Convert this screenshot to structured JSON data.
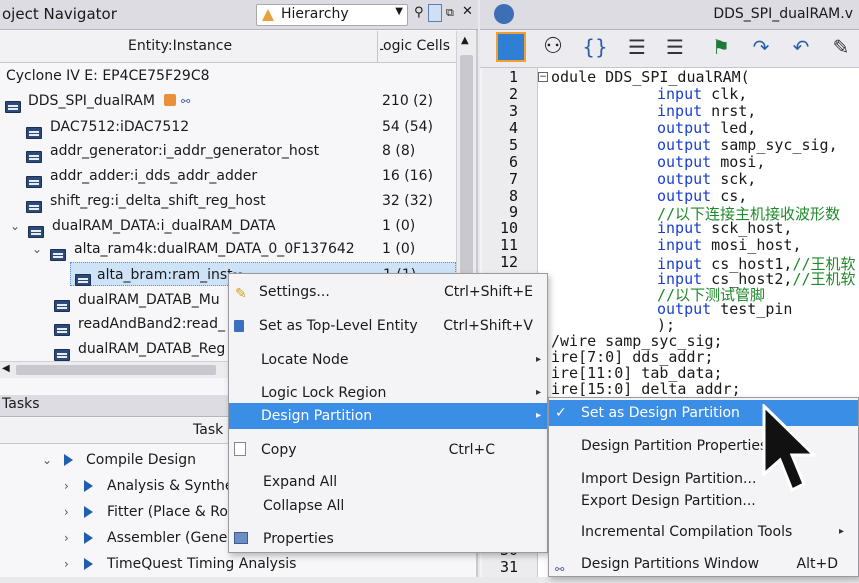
{
  "navigator": {
    "title": "oject Navigator",
    "view_select": "Hierarchy",
    "col_entity": "Entity:Instance",
    "col_cells": "Logic Cells",
    "device": "Cyclone IV E: EP4CE75F29C8",
    "rows": [
      {
        "label": "DDS_SPI_dualRAM",
        "cells": "210 (2)"
      },
      {
        "label": "DAC7512:iDAC7512",
        "cells": "54 (54)"
      },
      {
        "label": "addr_generator:i_addr_generator_host",
        "cells": "8 (8)"
      },
      {
        "label": "addr_adder:i_dds_addr_adder",
        "cells": "16 (16)"
      },
      {
        "label": "shift_reg:i_delta_shift_reg_host",
        "cells": "32 (32)"
      },
      {
        "label": "dualRAM_DATA:i_dualRAM_DATA",
        "cells": "1 (0)"
      },
      {
        "label": "alta_ram4k:dualRAM_DATA_0_0F137642",
        "cells": "1 (0)"
      },
      {
        "label": "alta_bram:ram_inst",
        "cells": "1 (1)"
      },
      {
        "label": "dualRAM_DATAB_Mu",
        "cells": ""
      },
      {
        "label": "readAndBand2:read_",
        "cells": ""
      },
      {
        "label": "dualRAM_DATAB_Reg",
        "cells": ""
      }
    ]
  },
  "tasks": {
    "title": "Tasks",
    "col_task": "Task",
    "items": [
      "Compile Design",
      "Analysis & Synthe",
      "Fitter (Place & Rou",
      "Assembler (Genera",
      "TimeQuest Timing Analysis"
    ]
  },
  "editor": {
    "tab_title": "DDS_SPI_dualRAM.v",
    "line_numbers": [
      "1",
      "2",
      "3",
      "4",
      "5",
      "6",
      "7",
      "8",
      "9",
      "10",
      "11",
      "12",
      "",
      "",
      "",
      "",
      "",
      "",
      "",
      "",
      "",
      "",
      "",
      "",
      "",
      "",
      "",
      "",
      "",
      "30",
      "31"
    ],
    "lines": [
      {
        "a": "odule DDS_SPI_dualRAM("
      },
      {
        "k": "input",
        "r": " clk,"
      },
      {
        "k": "input",
        "r": " nrst,"
      },
      {
        "k": "output",
        "r": " led,"
      },
      {
        "k": "output",
        "r": " samp_syc_sig,"
      },
      {
        "k": "output",
        "r": " mosi,"
      },
      {
        "k": "output",
        "r": " sck,"
      },
      {
        "k": "output",
        "r": " cs,"
      },
      {
        "c": "//以下连接主机接收波形数"
      },
      {
        "k": "input",
        "r": " sck_host,"
      },
      {
        "k": "input",
        "r": " mosi_host,"
      },
      {
        "k": "input",
        "r": " cs_host1,",
        "c2": "//王机软"
      },
      {
        "k": "input",
        "r": " cs_host2,",
        "c2": "//王机软"
      },
      {
        "c": "//以下测试管脚"
      },
      {
        "k": "output",
        "r": " test_pin"
      },
      {
        "a": ");"
      },
      {
        "a": "/wire samp_syc_sig;"
      },
      {
        "a": "ire[7:0] dds_addr;"
      },
      {
        "a": "ire[11:0] tab_data;"
      },
      {
        "a": "ire[15:0] delta_addr;"
      }
    ]
  },
  "context_menu": {
    "items": [
      {
        "label": "Settings...",
        "shortcut": "Ctrl+Shift+E"
      },
      {
        "label": "Set as Top-Level Entity",
        "shortcut": "Ctrl+Shift+V"
      },
      {
        "label": "Locate Node",
        "shortcut": ""
      },
      {
        "label": "Logic Lock Region",
        "shortcut": ""
      },
      {
        "label": "Design Partition",
        "shortcut": ""
      },
      {
        "label": "Copy",
        "shortcut": "Ctrl+C"
      },
      {
        "label": "Expand All",
        "shortcut": ""
      },
      {
        "label": "Collapse All",
        "shortcut": ""
      },
      {
        "label": "Properties",
        "shortcut": ""
      }
    ]
  },
  "submenu": {
    "items": [
      {
        "label": "Set as Design Partition",
        "shortcut": ""
      },
      {
        "label": "Design Partition Properties...",
        "shortcut": ""
      },
      {
        "label": "Import Design Partition...",
        "shortcut": ""
      },
      {
        "label": "Export Design Partition...",
        "shortcut": ""
      },
      {
        "label": "Incremental Compilation Tools",
        "shortcut": ""
      },
      {
        "label": "Design Partitions Window",
        "shortcut": "Alt+D"
      }
    ]
  },
  "colors": {
    "highlight": "#3a8ee6",
    "keyword": "#1a3fd0",
    "comment": "#1f8a2a",
    "chip": "#2c4a7a"
  }
}
